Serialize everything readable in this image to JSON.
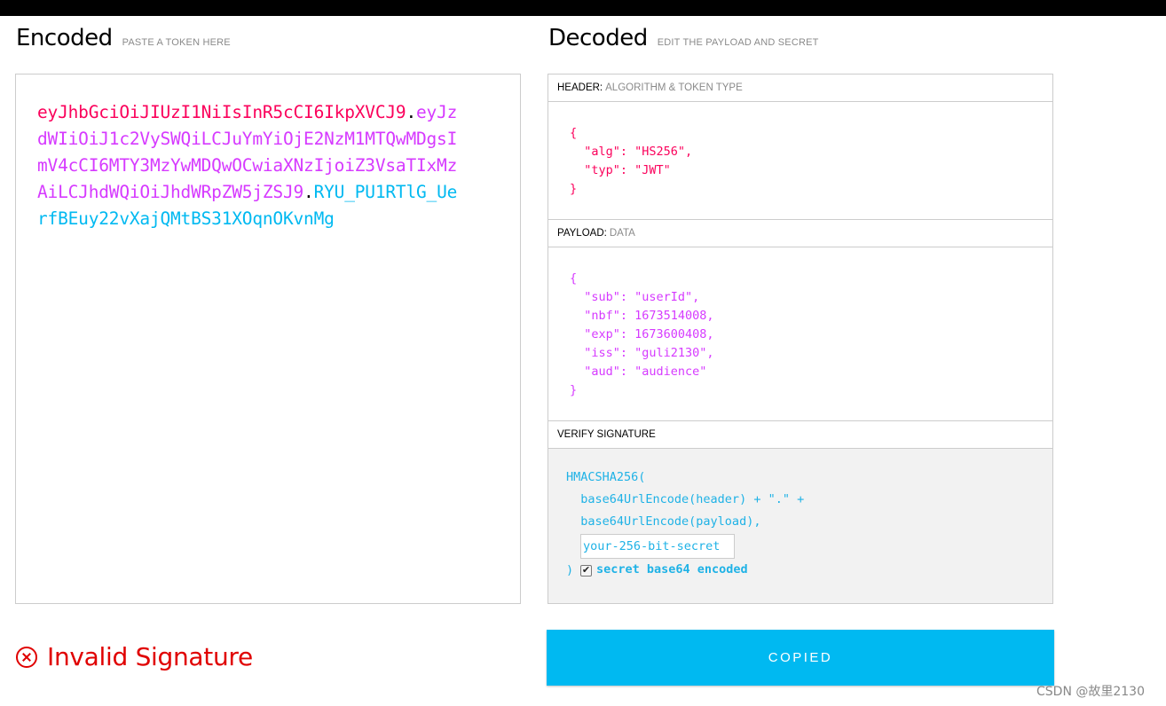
{
  "encoded": {
    "title": "Encoded",
    "subtitle": "PASTE A TOKEN HERE",
    "token_header": "eyJhbGciOiJIUzI1NiIsInR5cCI6IkpXVCJ9",
    "dot1": ".",
    "token_payload": "eyJzdWIiOiJ1c2VySWQiLCJuYmYiOjE2NzM1MTQwMDgsImV4cCI6MTY3MzYwMDQwOCwiaXNzIjoiZ3VsaTIxMzAiLCJhdWQiOiJhdWRpZW5jZSJ9",
    "dot2": ".",
    "token_signature": "RYU_PU1RTlG_UerfBEuy22vXajQMtBS31XOqnOKvnMg"
  },
  "decoded": {
    "title": "Decoded",
    "subtitle": "EDIT THE PAYLOAD AND SECRET",
    "header": {
      "label": "HEADER:",
      "sublabel": "ALGORITHM & TOKEN TYPE",
      "json": "{\n  \"alg\": \"HS256\",\n  \"typ\": \"JWT\"\n}"
    },
    "payload": {
      "label": "PAYLOAD:",
      "sublabel": "DATA",
      "json": "{\n  \"sub\": \"userId\",\n  \"nbf\": 1673514008,\n  \"exp\": 1673600408,\n  \"iss\": \"guli2130\",\n  \"aud\": \"audience\"\n}"
    },
    "signature": {
      "label": "VERIFY SIGNATURE",
      "line1": "HMACSHA256(",
      "line2": "  base64UrlEncode(header) + \".\" +",
      "line3": "  base64UrlEncode(payload),",
      "secret_value": "your-256-bit-secret",
      "closing": ")",
      "checkbox_checked": true,
      "checkbox_mark": "✔",
      "checkbox_label": "secret base64 encoded"
    }
  },
  "status": {
    "text": "Invalid Signature",
    "color": "#e00000"
  },
  "copied_button": "COPIED",
  "watermark": "CSDN @故里2130",
  "colors": {
    "header": "#fb015b",
    "payload": "#d63aff",
    "signature": "#00b9f1",
    "button": "#00b9f1"
  }
}
